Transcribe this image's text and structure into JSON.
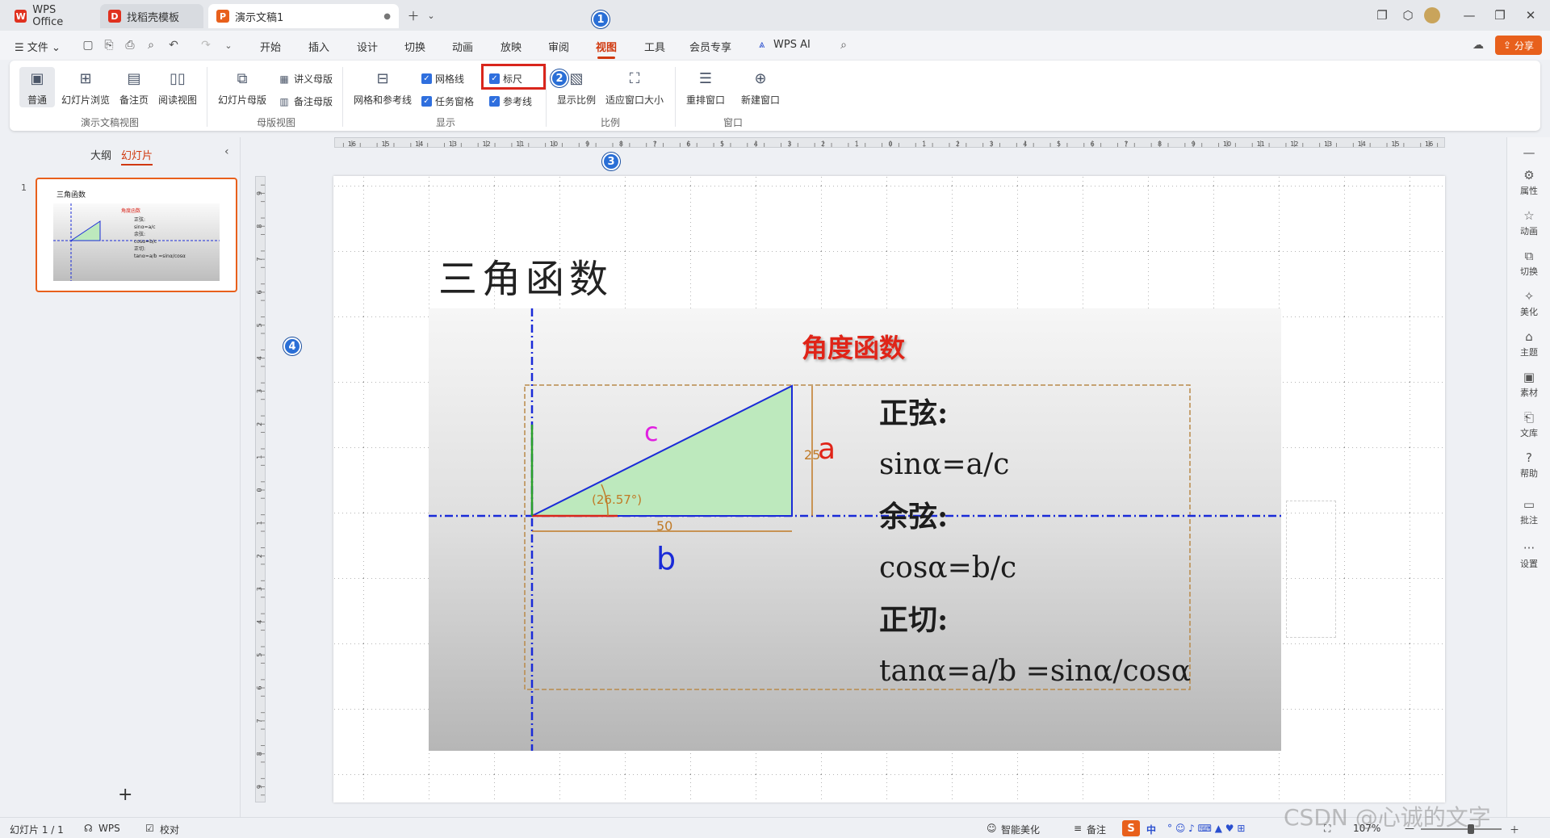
{
  "tabs": [
    {
      "label": "WPS Office"
    },
    {
      "label": "找稻壳模板"
    },
    {
      "label": "演示文稿1"
    }
  ],
  "menu": {
    "file": "文件",
    "items": [
      "开始",
      "插入",
      "设计",
      "切换",
      "动画",
      "放映",
      "审阅",
      "视图",
      "工具",
      "会员专享",
      "WPS AI"
    ],
    "share": "分享"
  },
  "ribbon": {
    "normal": "普通",
    "slide_sorter": "幻灯片浏览",
    "notes_page": "备注页",
    "reading_view": "阅读视图",
    "group1": "演示文稿视图",
    "slide_master": "幻灯片母版",
    "handout_master": "讲义母版",
    "notes_master": "备注母版",
    "group2": "母版视图",
    "grid_guides": "网格和参考线",
    "gridlines": "网格线",
    "task_pane": "任务窗格",
    "ruler": "标尺",
    "guides": "参考线",
    "group3": "显示",
    "zoom_ratio": "显示比例",
    "fit_window": "适应窗口大小",
    "group4": "比例",
    "arrange": "重排窗口",
    "new_window": "新建窗口",
    "group5": "窗口"
  },
  "badges": [
    "1",
    "2",
    "3",
    "4"
  ],
  "leftpanel": {
    "outline": "大纲",
    "slides": "幻灯片",
    "slide_number": "1"
  },
  "ruler": {
    "h_ticks": [
      "16",
      "15",
      "14",
      "13",
      "12",
      "11",
      "10",
      "9",
      "8",
      "7",
      "6",
      "5",
      "4",
      "3",
      "2",
      "1",
      "0",
      "1",
      "2",
      "3",
      "4",
      "5",
      "6",
      "7",
      "8",
      "9",
      "10",
      "11",
      "12",
      "13",
      "14",
      "15",
      "16"
    ],
    "v_ticks": [
      "9",
      "8",
      "7",
      "6",
      "5",
      "4",
      "3",
      "2",
      "1",
      "0",
      "1",
      "2",
      "3",
      "4",
      "5",
      "6",
      "7",
      "8",
      "9"
    ]
  },
  "slide": {
    "title": "三角函数",
    "subtitle": "角度函数",
    "label_c": "c",
    "label_a": "a",
    "label_b": "b",
    "dim_25": "25",
    "dim_50": "50",
    "angle": "(26.57°)",
    "lines": [
      "正弦:",
      "sinα=a/c",
      "余弦:",
      "cosα=b/c",
      "正切:",
      "tanα=a/b  =sinα/cosα"
    ]
  },
  "thumb": {
    "title": "三角函数",
    "sub": "角度函数",
    "l1": "正弦:",
    "l2": "sinα=a/c",
    "l3": "余弦:",
    "l4": "cosα=b/c",
    "l5": "正切:",
    "l6": "tanα=a/b =sinα/cosα"
  },
  "rightbar": [
    "属性",
    "动画",
    "切换",
    "美化",
    "主题",
    "素材",
    "文库",
    "帮助",
    "批注",
    "设置"
  ],
  "status": {
    "slide_count": "幻灯片 1 / 1",
    "wps": "WPS",
    "proof": "校对",
    "beautify": "智能美化",
    "notes": "备注",
    "ime": "中",
    "zoom": "107%",
    "watermark": "CSDN @心诚的文字"
  },
  "colors": {
    "accent": "#d0380e",
    "badge": "#2a6fd6",
    "triangle_fill": "#bde9bd",
    "triangle_edge": "#1a2bd8"
  }
}
